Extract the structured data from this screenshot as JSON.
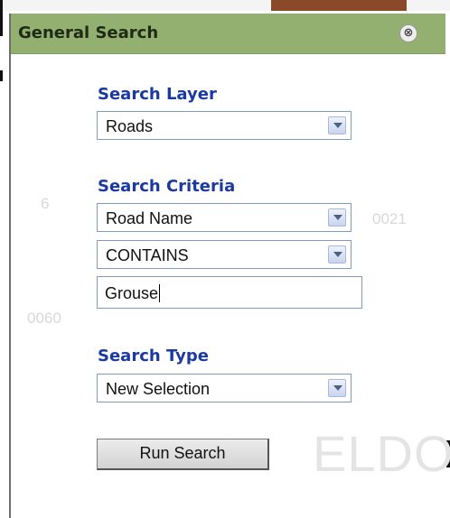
{
  "dialog": {
    "title": "General Search",
    "close_icon": "⊗"
  },
  "search_layer": {
    "label": "Search Layer",
    "selected": "Roads"
  },
  "search_criteria": {
    "label": "Search Criteria",
    "field_selected": "Road Name",
    "operator_selected": "CONTAINS",
    "value": "Grouse"
  },
  "search_type": {
    "label": "Search Type",
    "selected": "New Selection"
  },
  "run_button": {
    "label": "Run Search"
  },
  "map_background": {
    "labels": [
      "0060",
      "0021",
      "6"
    ],
    "place_label": "ELDO"
  },
  "colors": {
    "title_bar": "#94b071",
    "section_label": "#1a3aa0"
  }
}
